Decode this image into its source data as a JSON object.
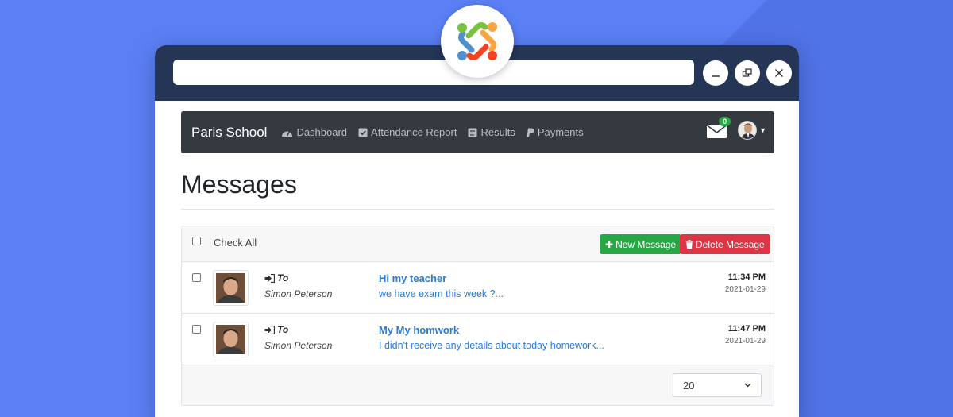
{
  "app": {
    "brand": "Paris School",
    "nav": [
      {
        "label": "Dashboard",
        "icon": "dashboard-icon"
      },
      {
        "label": "Attendance Report",
        "icon": "checkbox-icon"
      },
      {
        "label": "Results",
        "icon": "results-icon"
      },
      {
        "label": "Payments",
        "icon": "paypal-icon"
      }
    ],
    "mail_count": "0"
  },
  "page": {
    "title": "Messages",
    "check_all": "Check All",
    "new_message": "New Message",
    "delete_message": "Delete Message",
    "page_size": "20"
  },
  "messages": [
    {
      "to_label": "To",
      "recipient": "Simon Peterson",
      "subject": "Hi my teacher",
      "preview": "we have exam this week ?...",
      "time": "11:34 PM",
      "date": "2021-01-29"
    },
    {
      "to_label": "To",
      "recipient": "Simon Peterson",
      "subject": "My My homwork",
      "preview": "I didn't receive any details about today homework...",
      "time": "11:47 PM",
      "date": "2021-01-29"
    }
  ],
  "colors": {
    "background": "#5b80f6",
    "titlebar": "#253556",
    "navbar": "#343a40",
    "success": "#28a745",
    "danger": "#dc3545",
    "link": "#2a7bd5"
  }
}
